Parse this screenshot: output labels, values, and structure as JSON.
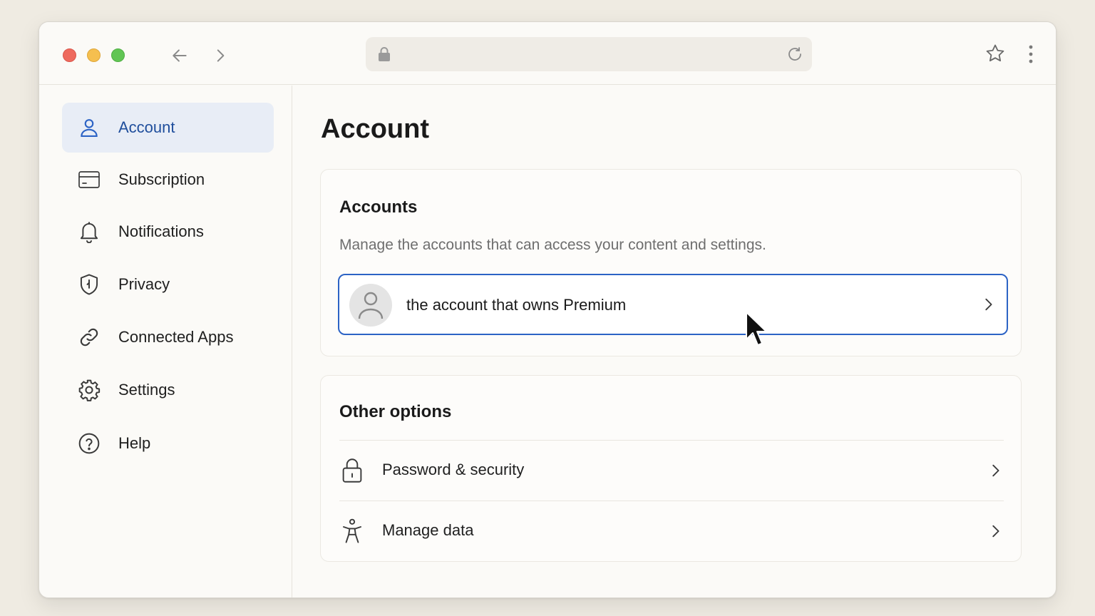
{
  "browser": {
    "url": "",
    "icons": {
      "back": "arrow-left-icon",
      "forward": "arrow-right-icon",
      "lock": "lock-icon",
      "reload": "reload-icon",
      "bookmark": "star-icon",
      "menu": "kebab-menu-icon"
    }
  },
  "sidebar": {
    "items": [
      {
        "label": "Account",
        "icon": "user-icon",
        "active": true
      },
      {
        "label": "Subscription",
        "icon": "credit-card-icon"
      },
      {
        "label": "Notifications",
        "icon": "bell-icon"
      },
      {
        "label": "Privacy",
        "icon": "shield-icon"
      },
      {
        "label": "Connected Apps",
        "icon": "link-icon"
      },
      {
        "label": "Settings",
        "icon": "gear-icon"
      },
      {
        "label": "Help",
        "icon": "help-circle-icon"
      }
    ]
  },
  "main": {
    "title": "Account",
    "accounts_card": {
      "title": "Accounts",
      "description": "Manage the accounts that can access your content and settings.",
      "account_label": "the account that owns Premium"
    },
    "other_card": {
      "title": "Other options",
      "options": [
        {
          "label": "Password & security",
          "icon": "lock-icon"
        },
        {
          "label": "Manage data",
          "icon": "accessibility-icon"
        }
      ]
    }
  },
  "colors": {
    "accent": "#2c63c5",
    "active_bg": "#e8edf6",
    "active_text": "#1f4e9c",
    "background": "#efebe2"
  }
}
